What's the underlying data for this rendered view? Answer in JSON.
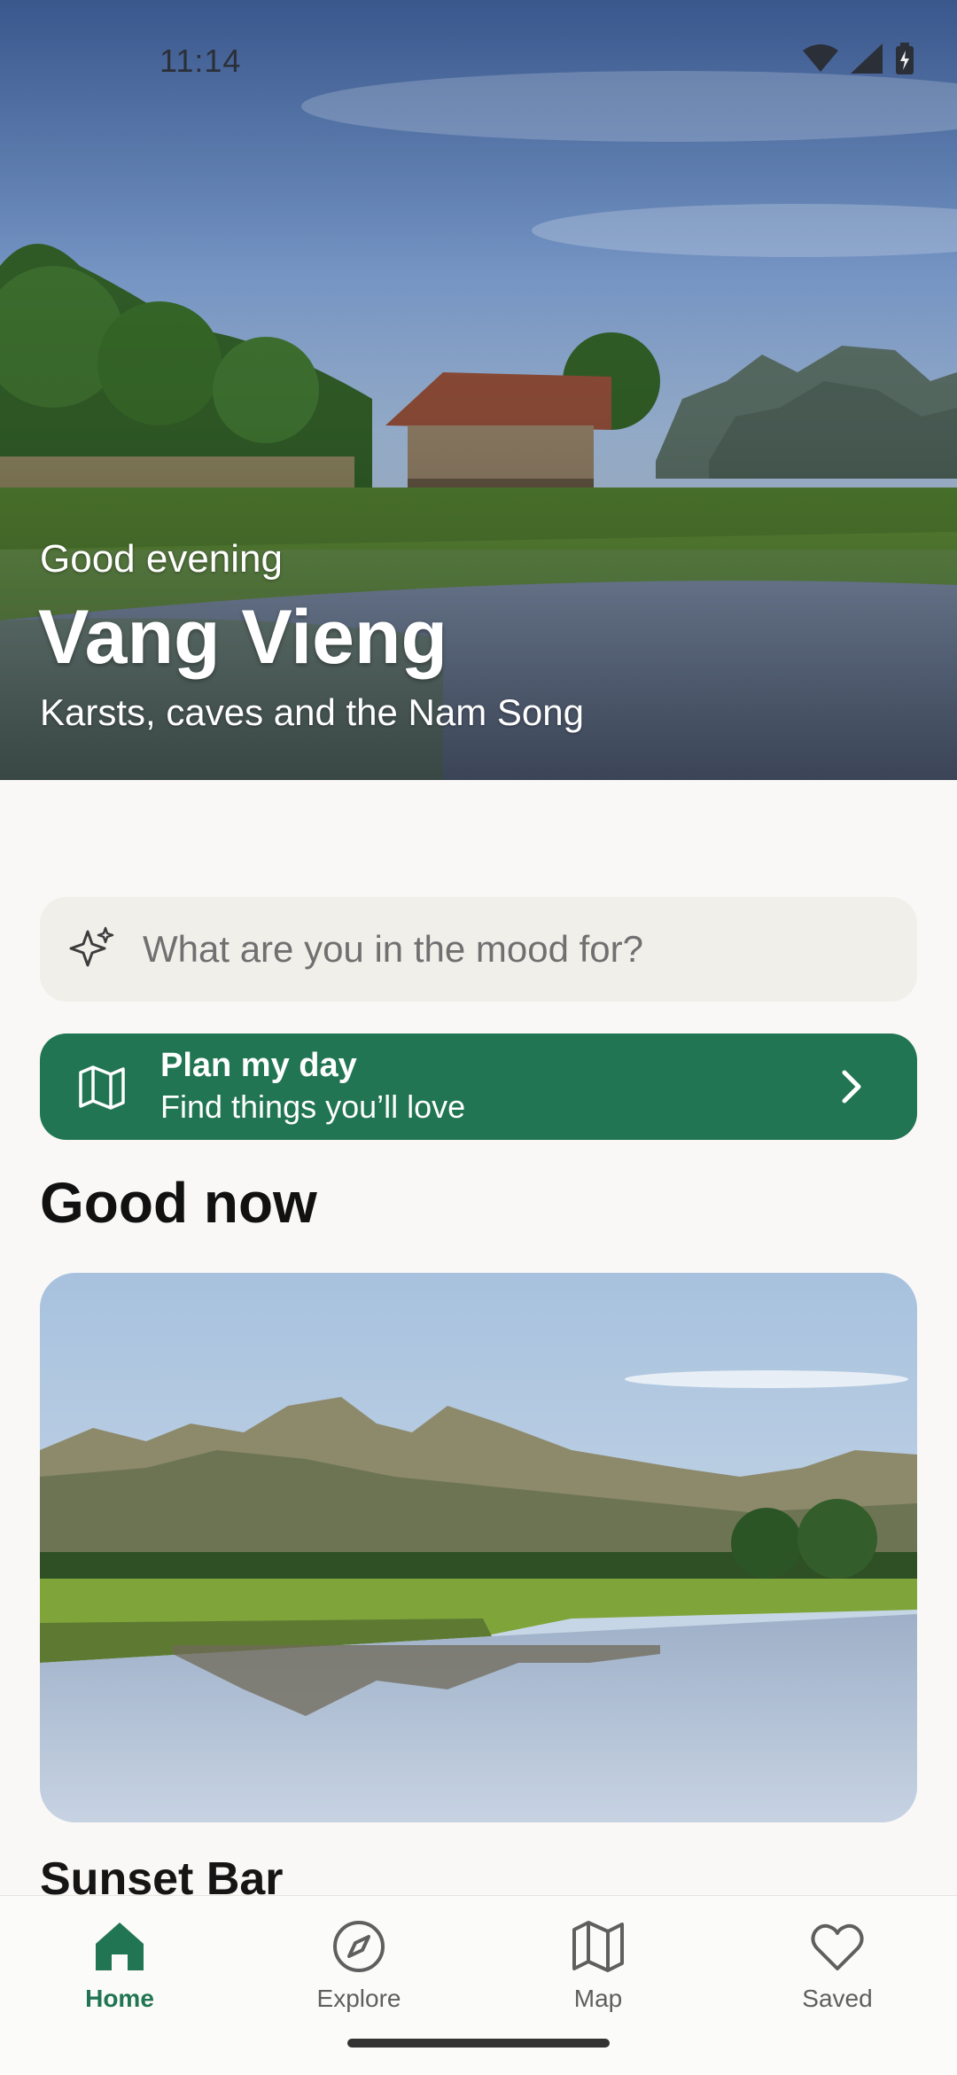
{
  "status_bar": {
    "time": "11:14"
  },
  "hero": {
    "greeting": "Good evening",
    "city": "Vang Vieng",
    "tagline": "Karsts, caves and the Nam Song"
  },
  "search": {
    "placeholder": "What are you in the mood for?",
    "icon": "sparkle-icon"
  },
  "plan_button": {
    "title": "Plan my day",
    "subtitle": "Find things you’ll love",
    "icon": "map-icon"
  },
  "section": {
    "title": "Good now"
  },
  "card": {
    "title": "Sunset Bar"
  },
  "bottom_nav": {
    "items": [
      {
        "label": "Home",
        "icon": "home-icon",
        "active": true
      },
      {
        "label": "Explore",
        "icon": "compass-icon",
        "active": false
      },
      {
        "label": "Map",
        "icon": "map-icon",
        "active": false
      },
      {
        "label": "Saved",
        "icon": "heart-icon",
        "active": false
      }
    ]
  },
  "colors": {
    "accent": "#217552",
    "background": "#f9f8f6",
    "search_bg": "#f0efea"
  }
}
